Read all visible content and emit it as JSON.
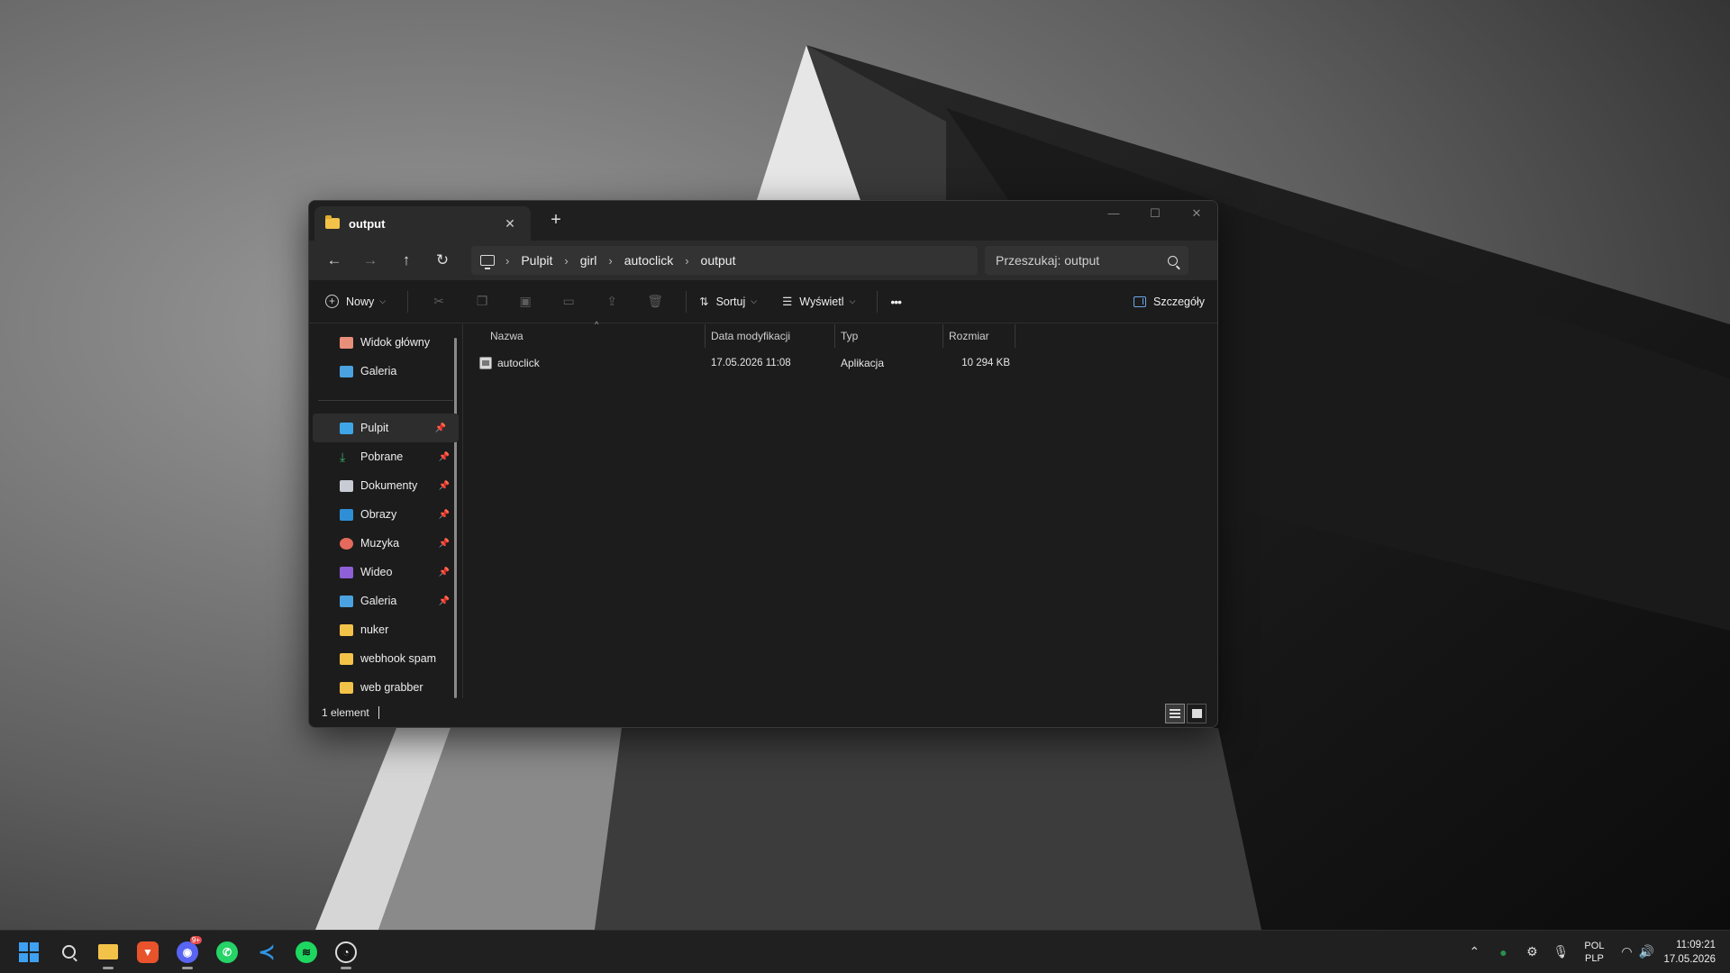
{
  "window": {
    "tab_title": "output",
    "tab_close": "✕",
    "new_tab": "+",
    "controls": {
      "minimize": "—",
      "maximize": "☐",
      "close": "✕"
    }
  },
  "navbar": {
    "back": "←",
    "forward": "→",
    "up": "↑",
    "refresh": "↻",
    "breadcrumb": [
      "Pulpit",
      "girl",
      "autoclick",
      "output"
    ],
    "separator": "›",
    "search_placeholder": "Przeszukaj: output"
  },
  "toolbar": {
    "new_label": "Nowy",
    "sort_label": "Sortuj",
    "view_label": "Wyświetl",
    "more_label": "•••",
    "details_label": "Szczegóły",
    "icons": [
      "cut-icon",
      "copy-icon",
      "paste-icon",
      "rename-icon",
      "share-icon",
      "delete-icon"
    ]
  },
  "sidebar": {
    "top": [
      {
        "label": "Widok główny",
        "icon": "home-icon"
      },
      {
        "label": "Galeria",
        "icon": "gallery-icon"
      }
    ],
    "pinned": [
      {
        "label": "Pulpit",
        "icon": "desktop-icon",
        "pinned": true,
        "active": true
      },
      {
        "label": "Pobrane",
        "icon": "downloads-icon",
        "pinned": true
      },
      {
        "label": "Dokumenty",
        "icon": "documents-icon",
        "pinned": true
      },
      {
        "label": "Obrazy",
        "icon": "pictures-icon",
        "pinned": true
      },
      {
        "label": "Muzyka",
        "icon": "music-icon",
        "pinned": true
      },
      {
        "label": "Wideo",
        "icon": "video-icon",
        "pinned": true
      },
      {
        "label": "Galeria",
        "icon": "gallery-icon",
        "pinned": true
      },
      {
        "label": "nuker",
        "icon": "folder-icon"
      },
      {
        "label": "webhook spam",
        "icon": "folder-icon"
      },
      {
        "label": "web grabber",
        "icon": "folder-icon"
      }
    ]
  },
  "files": {
    "columns": [
      "Nazwa",
      "Data modyfikacji",
      "Typ",
      "Rozmiar"
    ],
    "rows": [
      {
        "name": "autoclick",
        "modified": "17.05.2026 11:08",
        "type": "Aplikacja",
        "size": "10 294 KB"
      }
    ]
  },
  "status": {
    "count": "1 element"
  },
  "taskbar": {
    "apps": [
      "start-icon",
      "search-icon",
      "file-explorer-icon",
      "brave-icon",
      "discord-icon",
      "whatsapp-icon",
      "vscode-icon",
      "spotify-icon",
      "obs-icon"
    ],
    "discord_badge": "9+",
    "language": [
      "POL",
      "PLP"
    ],
    "time": "11:09:21",
    "date": "17.05.2026"
  }
}
